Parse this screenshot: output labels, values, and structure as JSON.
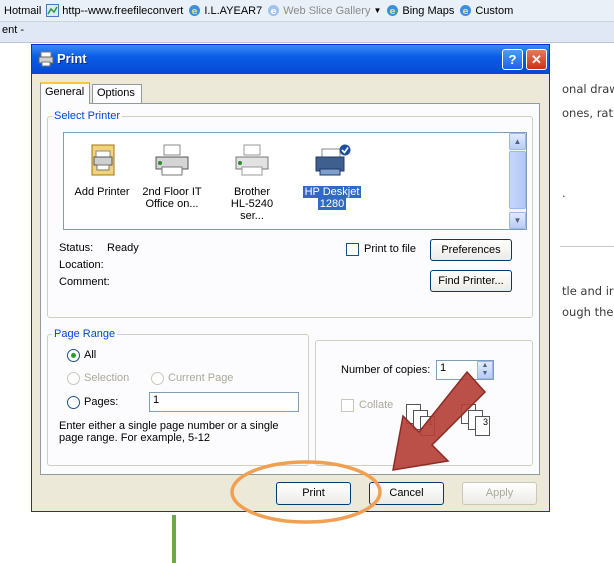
{
  "favorites": {
    "items": [
      {
        "label": "Hotmail",
        "icon": "none"
      },
      {
        "label": "http--www.freefileconvert",
        "icon": "web-icon"
      },
      {
        "label": "I.L.AYEAR7",
        "icon": "ie-icon"
      },
      {
        "label": "Web Slice Gallery",
        "icon": "ie-icon",
        "dimmed": true
      },
      {
        "label": "Bing Maps",
        "icon": "ie-icon"
      },
      {
        "label": "Custom",
        "icon": "ie-icon"
      }
    ]
  },
  "tab_fragment": "ent -",
  "background_page": {
    "lines": [
      "onal draw",
      "ones, rat",
      ".",
      "tle and ir",
      "ough the"
    ]
  },
  "dialog": {
    "title": "Print",
    "help_label": "?",
    "close_label": "✕",
    "tabs": [
      "General",
      "Options"
    ],
    "active_tab": "General",
    "select_printer": {
      "legend": "Select Printer",
      "printers": [
        {
          "line1": "Add Printer",
          "line2": "",
          "icon": "add-printer-icon",
          "selected": false
        },
        {
          "line1": "2nd Floor IT",
          "line2": "Office on...",
          "icon": "printer-icon",
          "selected": false
        },
        {
          "line1": "Brother",
          "line2": "HL-5240 ser...",
          "icon": "printer-icon",
          "selected": false
        },
        {
          "line1": "HP Deskjet",
          "line2": "1280",
          "icon": "default-printer-icon",
          "selected": true
        }
      ],
      "status_label": "Status:",
      "status_value": "Ready",
      "location_label": "Location:",
      "location_value": "",
      "comment_label": "Comment:",
      "comment_value": "",
      "print_to_file_label": "Print to file",
      "print_to_file_checked": false,
      "preferences_label": "Preferences",
      "find_printer_label": "Find Printer..."
    },
    "page_range": {
      "legend": "Page Range",
      "all_label": "All",
      "selection_label": "Selection",
      "current_page_label": "Current Page",
      "pages_label": "Pages:",
      "pages_value": "1",
      "selected_option": "All",
      "hint": "Enter either a single page number or a single page range.  For example, 5-12"
    },
    "copies": {
      "label": "Number of copies:",
      "value": "1",
      "collate_label": "Collate",
      "collate_checked": false,
      "collate_numbers": [
        "1",
        "2",
        "3"
      ]
    },
    "buttons": {
      "print": "Print",
      "cancel": "Cancel",
      "apply": "Apply"
    }
  },
  "annotations": {
    "arrow_color": "#b5413a",
    "ellipse_color": "#f0a050",
    "line_color": "#6aaa4a"
  }
}
